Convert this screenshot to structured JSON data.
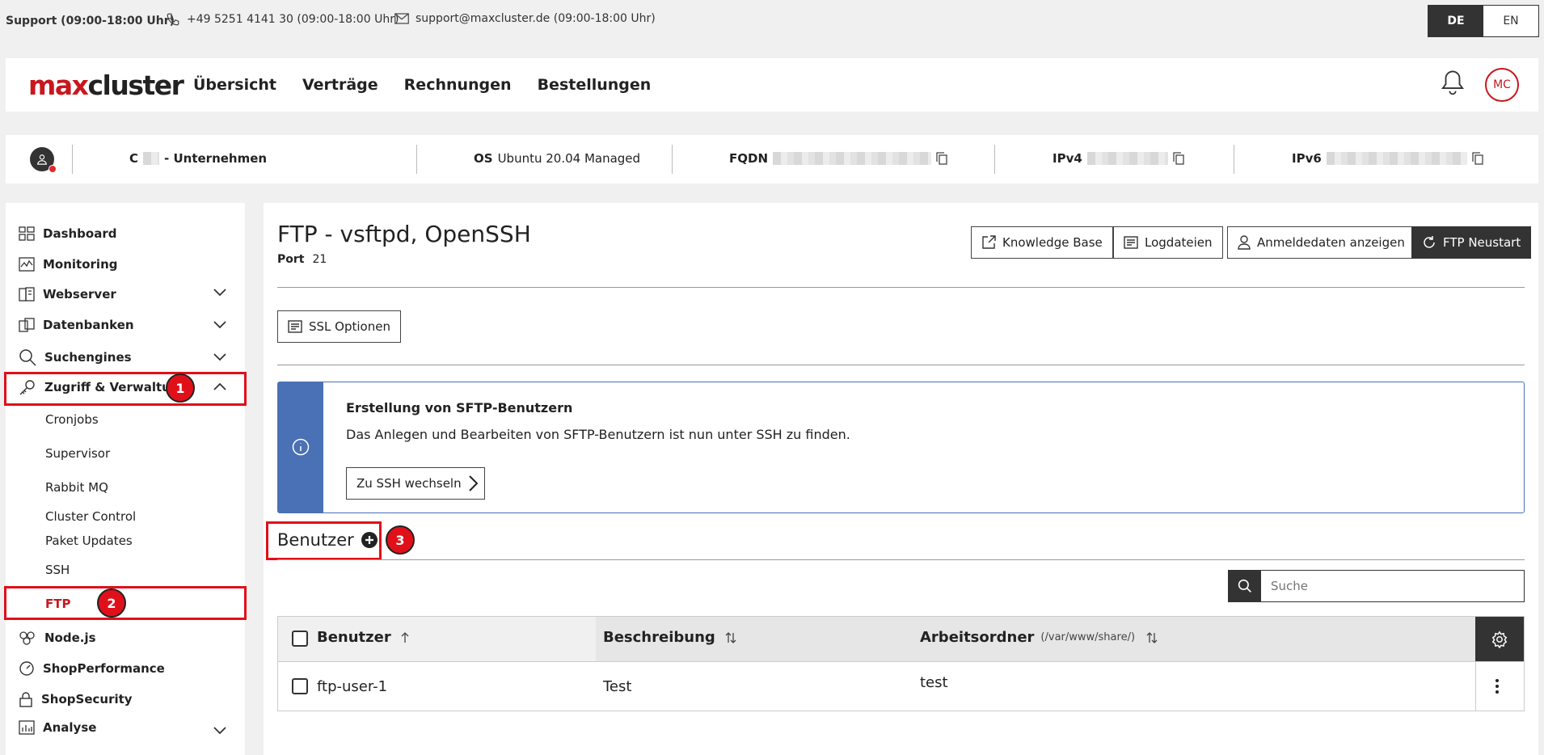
{
  "topbar": {
    "support_label": "Support (09:00-18:00 Uhr)",
    "phone": "+49 5251 4141 30 (09:00-18:00 Uhr)",
    "email": "support@maxcluster.de (09:00-18:00 Uhr)",
    "lang_de": "DE",
    "lang_en": "EN"
  },
  "nav": {
    "logo_max": "max",
    "logo_cluster": "cluster",
    "links": [
      "Übersicht",
      "Verträge",
      "Rechnungen",
      "Bestellungen"
    ],
    "avatar": "MC"
  },
  "infobar": {
    "company_prefix": "C",
    "company_suffix": "- Unternehmen",
    "os_label": "OS",
    "os_value": "Ubuntu 20.04 Managed",
    "fqdn_label": "FQDN",
    "ipv4_label": "IPv4",
    "ipv6_label": "IPv6"
  },
  "sidebar": {
    "items": [
      {
        "label": "Dashboard",
        "icon": "dashboard-icon"
      },
      {
        "label": "Monitoring",
        "icon": "monitoring-icon"
      },
      {
        "label": "Webserver",
        "icon": "webserver-icon"
      },
      {
        "label": "Datenbanken",
        "icon": "database-icon"
      },
      {
        "label": "Suchengines",
        "icon": "search-icon"
      },
      {
        "label": "Zugriff & Verwaltung",
        "icon": "key-icon"
      },
      {
        "label": "Node.js",
        "icon": "nodejs-icon"
      },
      {
        "label": "ShopPerformance",
        "icon": "gauge-icon"
      },
      {
        "label": "ShopSecurity",
        "icon": "lock-icon"
      },
      {
        "label": "Analyse",
        "icon": "analytics-icon"
      }
    ],
    "subitems": [
      "Cronjobs",
      "Supervisor",
      "Rabbit MQ",
      "Cluster Control",
      "Paket Updates",
      "SSH",
      "FTP"
    ],
    "badges": [
      "1",
      "2",
      "3"
    ]
  },
  "main": {
    "title": "FTP - vsftpd, OpenSSH",
    "port_label": "Port",
    "port_value": "21",
    "buttons": {
      "knowledge": "Knowledge Base",
      "logs": "Logdateien",
      "credentials": "Anmeldedaten anzeigen",
      "restart": "FTP Neustart",
      "ssl": "SSL Optionen"
    },
    "notice": {
      "title": "Erstellung von SFTP-Benutzern",
      "text": "Das Anlegen und Bearbeiten von SFTP-Benutzern ist nun unter SSH zu finden.",
      "button": "Zu SSH wechseln"
    },
    "users_heading": "Benutzer",
    "search_placeholder": "Suche",
    "table": {
      "col_user": "Benutzer",
      "col_desc": "Beschreibung",
      "col_dir": "Arbeitsordner",
      "col_dir_hint": "(/var/www/share/)",
      "rows": [
        {
          "user": "ftp-user-1",
          "desc": "Test",
          "dir": "test"
        }
      ]
    }
  }
}
